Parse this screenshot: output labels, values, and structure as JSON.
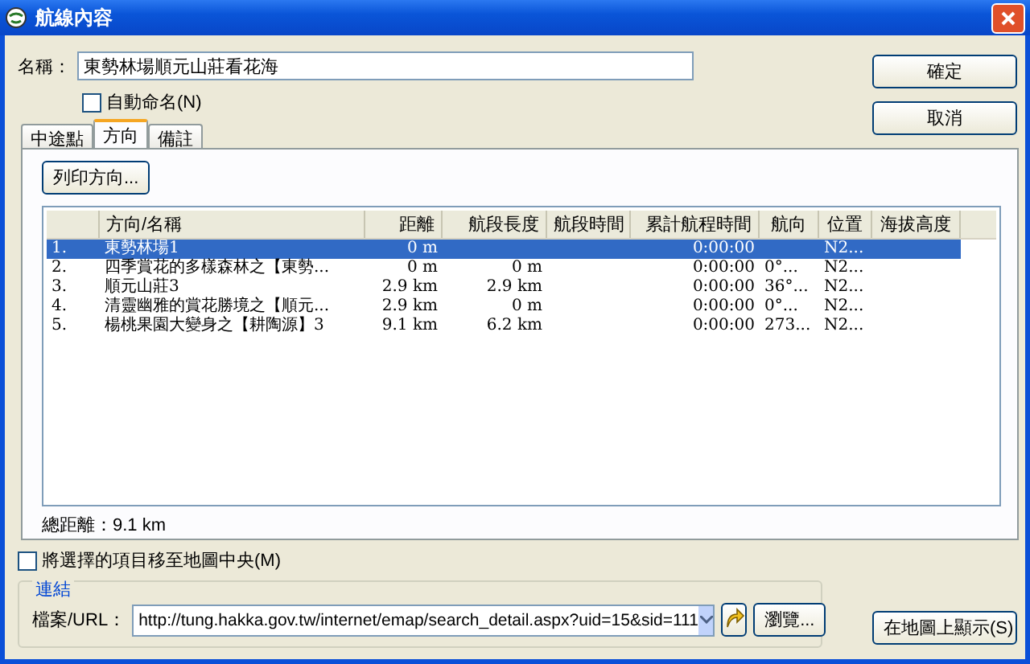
{
  "window": {
    "title": "航線內容"
  },
  "name_field": {
    "label": "名稱：",
    "value": "東勢林場順元山莊看花海"
  },
  "auto_name": {
    "label": "自動命名(N)",
    "checked": false
  },
  "buttons": [
    {
      "label": "確定"
    },
    {
      "label": "取消"
    }
  ],
  "tabs": [
    {
      "label": "中途點",
      "selected": false
    },
    {
      "label": "方向",
      "selected": true
    },
    {
      "label": "備註",
      "selected": false
    }
  ],
  "print_button": "列印方向...",
  "table": {
    "columns": [
      "",
      "方向/名稱",
      "距離",
      "航段長度",
      "航段時間",
      "累計航程時間",
      "航向",
      "位置",
      "海拔高度"
    ],
    "rows": [
      {
        "cells": [
          "1.",
          "東勢林場1",
          "0 m",
          "",
          "",
          "0:00:00",
          "",
          "N2...",
          ""
        ],
        "selected": true
      },
      {
        "cells": [
          "2.",
          "四季賞花的多樣森林之【東勢...",
          "0 m",
          "0 m",
          "",
          "0:00:00",
          "0°...",
          "N2...",
          ""
        ],
        "selected": false
      },
      {
        "cells": [
          "3.",
          "順元山莊3",
          "2.9 km",
          "2.9 km",
          "",
          "0:00:00",
          "36°...",
          "N2...",
          ""
        ],
        "selected": false
      },
      {
        "cells": [
          "4.",
          "清靈幽雅的賞花勝境之【順元...",
          "2.9 km",
          "0 m",
          "",
          "0:00:00",
          "0°...",
          "N2...",
          ""
        ],
        "selected": false
      },
      {
        "cells": [
          "5.",
          "楊桃果園大變身之【耕陶源】3",
          "9.1 km",
          "6.2 km",
          "",
          "0:00:00",
          "273...",
          "N2...",
          ""
        ],
        "selected": false
      }
    ]
  },
  "total_distance": "總距離：9.1 km",
  "center_option": {
    "label": "將選擇的項目移至地圖中央(M)",
    "checked": false
  },
  "link_group": {
    "title": "連結",
    "label": "檔案/URL：",
    "value": "http://tung.hakka.gov.tw/internet/emap/search_detail.aspx?uid=15&sid=111",
    "browse_button": "瀏覽..."
  },
  "show_on_map_button": "在地圖上顯示(S)"
}
